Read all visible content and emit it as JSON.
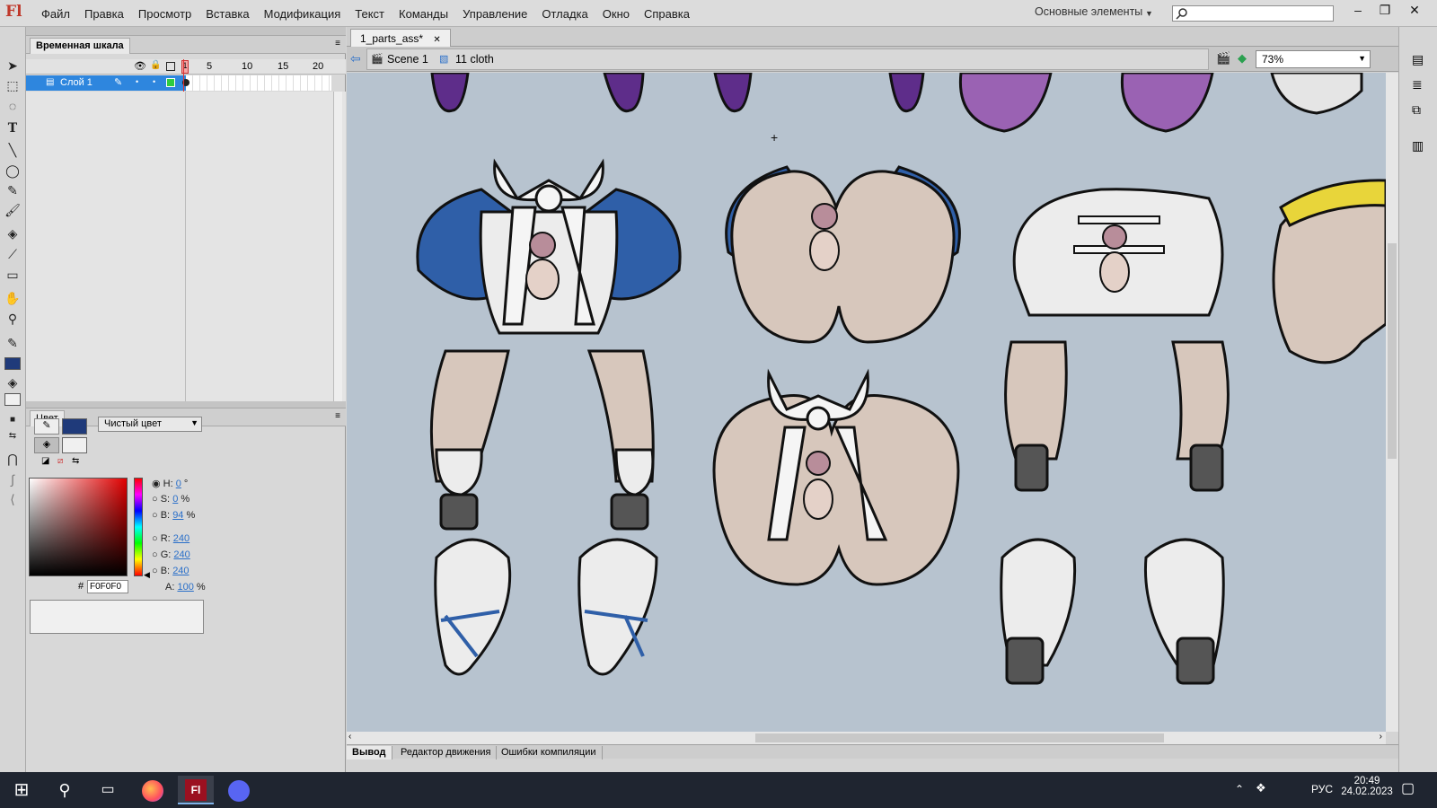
{
  "app": {
    "logo": "Fl"
  },
  "menu": [
    "Файл",
    "Правка",
    "Просмотр",
    "Вставка",
    "Модификация",
    "Текст",
    "Команды",
    "Управление",
    "Отладка",
    "Окно",
    "Справка"
  ],
  "workspace": {
    "label": "Основные элементы"
  },
  "search": {
    "placeholder": ""
  },
  "timeline": {
    "tab": "Временная шкала",
    "frame_numbers": [
      "1",
      "5",
      "10",
      "15",
      "20"
    ],
    "layer_name": "Слой 1"
  },
  "color_panel": {
    "tab": "Цвет",
    "fill_type": "Чистый цвет",
    "H": "0",
    "H_unit": "°",
    "S": "0",
    "S_unit": "%",
    "B": "94",
    "B_unit": "%",
    "R": "240",
    "G": "240",
    "Bl": "240",
    "A": "100",
    "A_unit": "%",
    "hex": "F0F0F0",
    "hex_label": "#",
    "labels": {
      "H": "H:",
      "S": "S:",
      "B": "B:",
      "R": "R:",
      "G": "G:",
      "Bl": "B:",
      "A": "A:"
    },
    "stroke_color": "#1f3a7a",
    "fill_color": "#f0f0f0"
  },
  "document": {
    "tab": "1_parts_ass*",
    "scene": "Scene 1",
    "symbol": "11 cloth",
    "zoom": "73%"
  },
  "output_tabs": [
    "Вывод",
    "Редактор движения",
    "Ошибки компиляции"
  ],
  "taskbar": {
    "lang": "РУС",
    "time": "20:49",
    "date": "24.02.2023"
  },
  "colors": {
    "stage_bg": "#b7c3cf",
    "accent_blue": "#2e86de",
    "taskbar": "#1f2530"
  }
}
